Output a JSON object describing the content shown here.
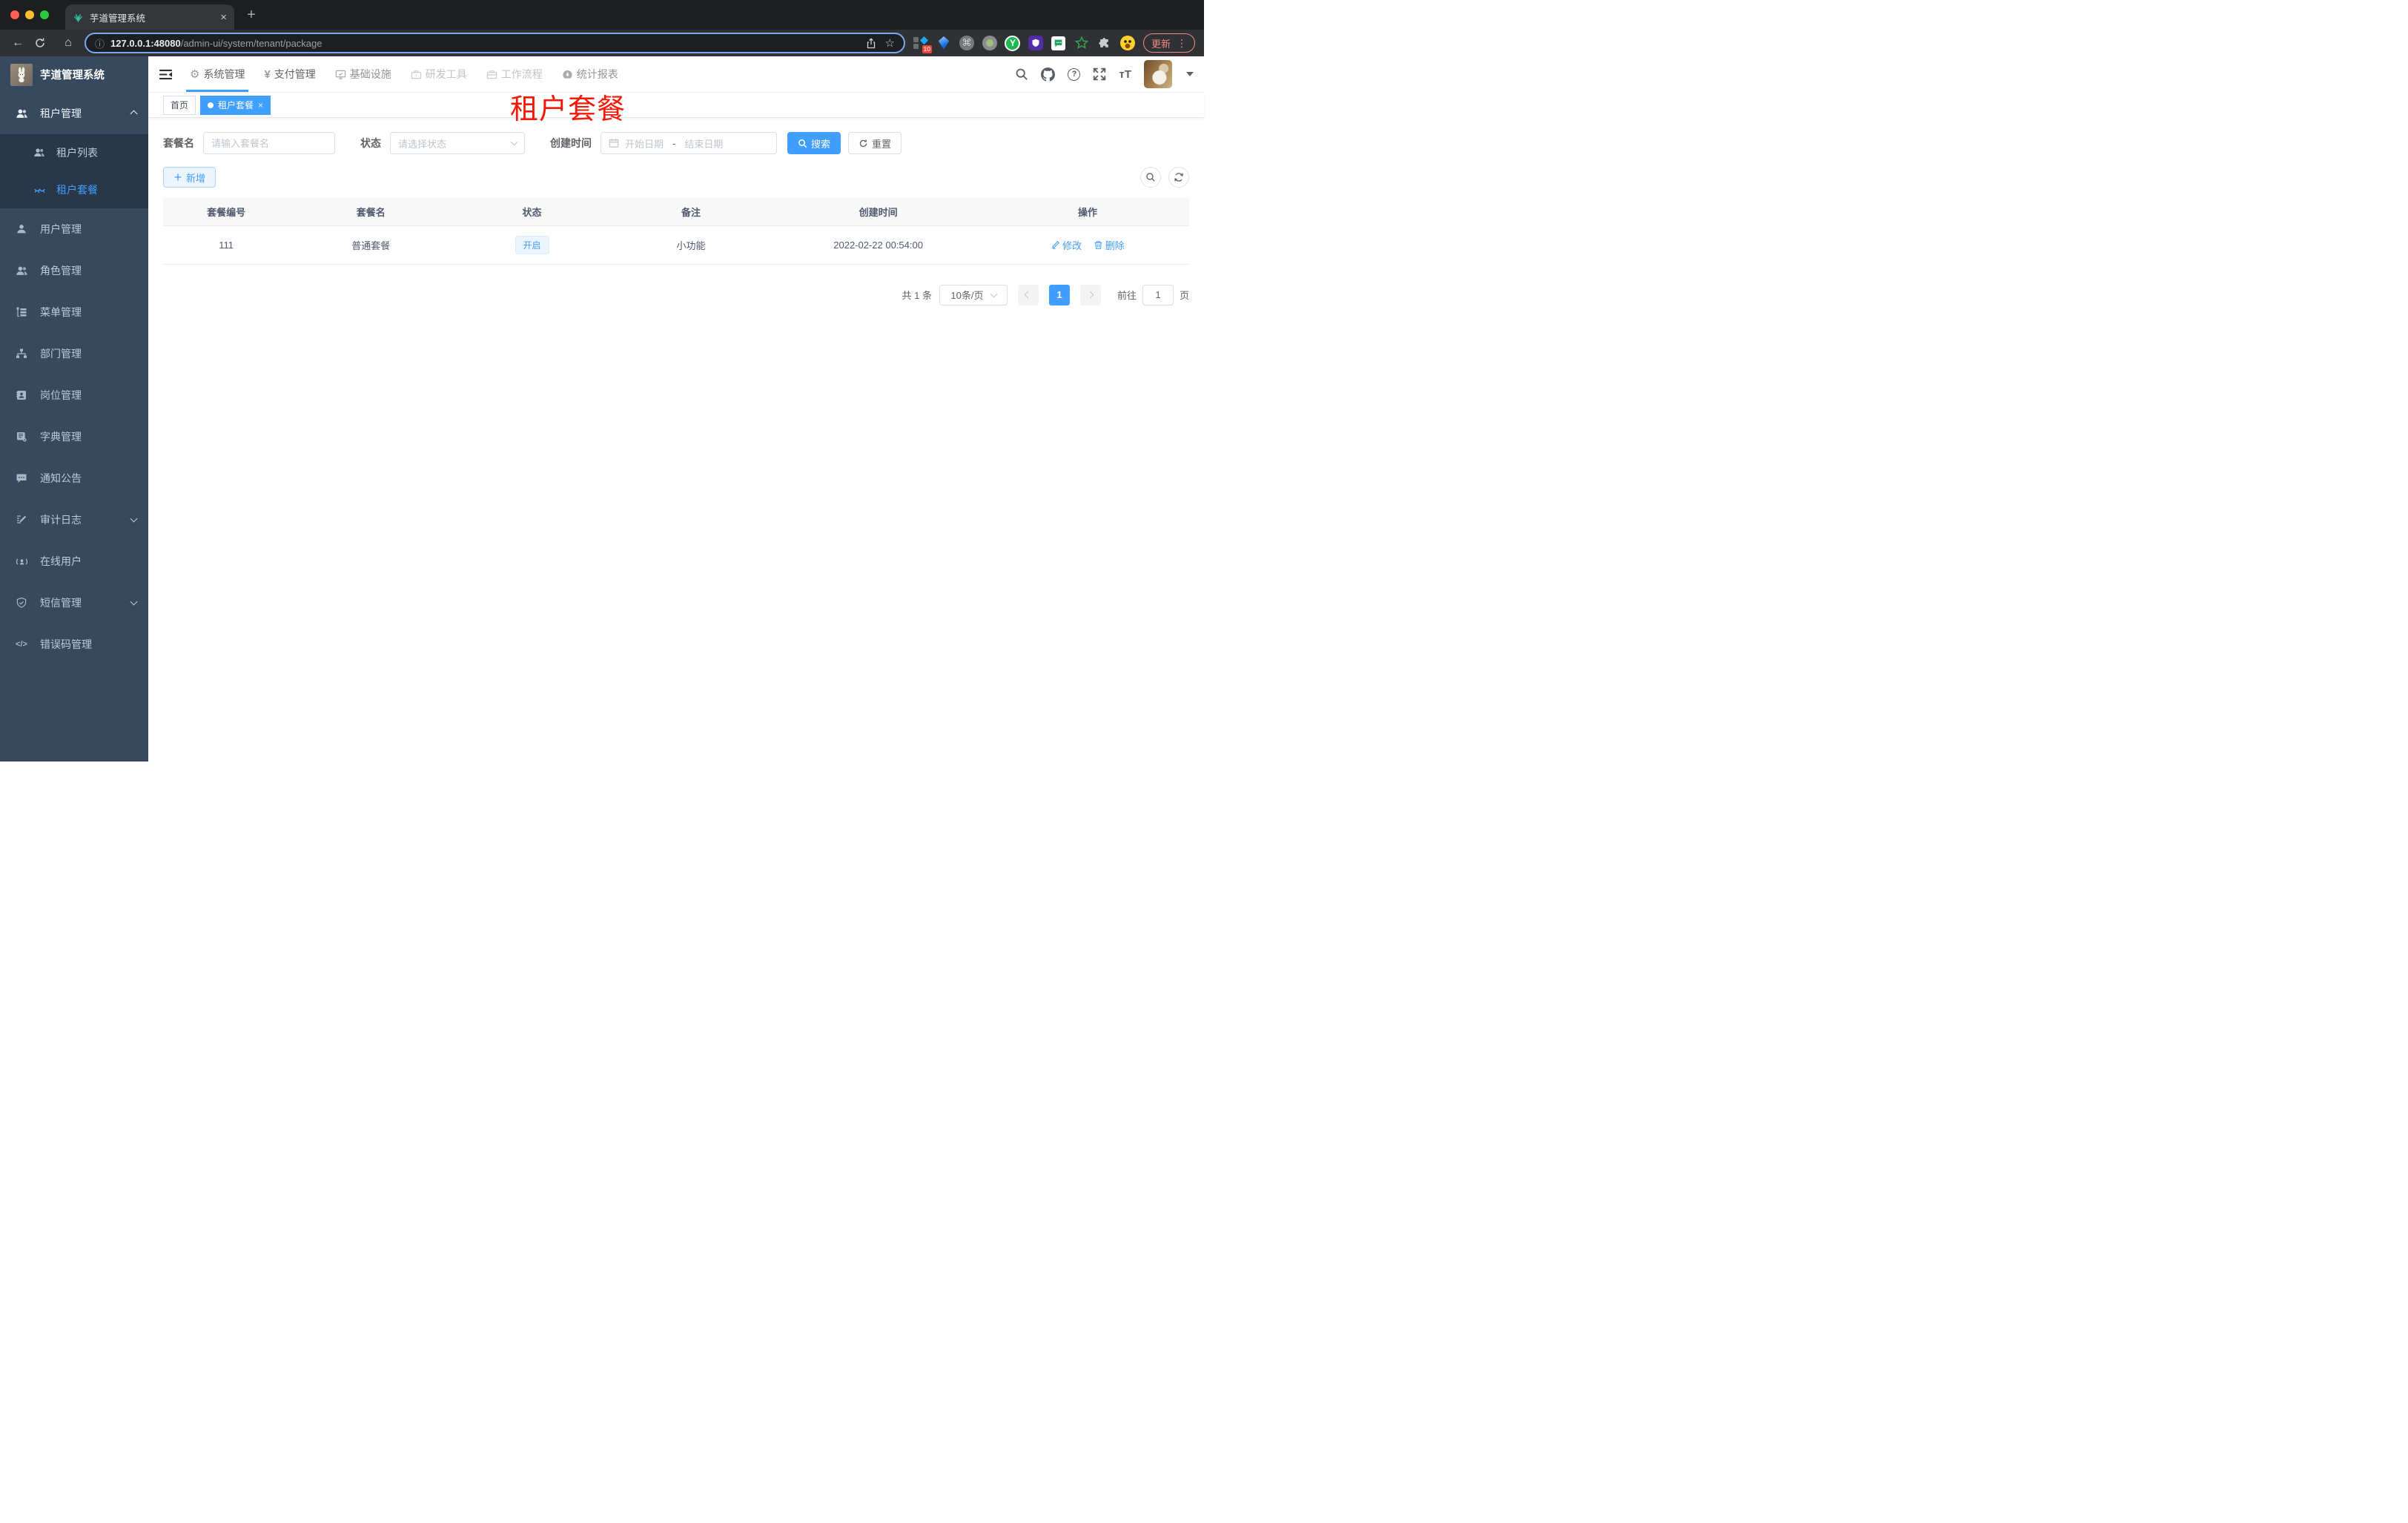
{
  "browser": {
    "tab_title": "芋道管理系统",
    "url_host": "127.0.0.1:48080",
    "url_path": "/admin-ui/system/tenant/package",
    "update_label": "更新",
    "ext_badge": "10"
  },
  "icons": {
    "close": "×",
    "new_tab": "+",
    "back": "←",
    "home": "⌂",
    "info": "ⓘ",
    "star": "☆",
    "command": "⌘",
    "kebab": "⋮",
    "gear": "⚙",
    "yen": "¥",
    "question": "?",
    "font_size": "тT",
    "code": "</>",
    "ext_y": "Y",
    "tag_close": "×"
  },
  "sidebar": {
    "app_title": "芋道管理系统",
    "items": [
      {
        "label": "租户管理"
      },
      {
        "label": "租户列表"
      },
      {
        "label": "租户套餐"
      },
      {
        "label": "用户管理"
      },
      {
        "label": "角色管理"
      },
      {
        "label": "菜单管理"
      },
      {
        "label": "部门管理"
      },
      {
        "label": "岗位管理"
      },
      {
        "label": "字典管理"
      },
      {
        "label": "通知公告"
      },
      {
        "label": "审计日志"
      },
      {
        "label": "在线用户"
      },
      {
        "label": "短信管理"
      },
      {
        "label": "错误码管理"
      }
    ]
  },
  "header": {
    "menus": [
      {
        "label": "系统管理"
      },
      {
        "label": "支付管理"
      },
      {
        "label": "基础设施"
      },
      {
        "label": "研发工具"
      },
      {
        "label": "工作流程"
      },
      {
        "label": "统计报表"
      }
    ]
  },
  "tags": {
    "home": "首页",
    "active": "租户套餐"
  },
  "overlay_title": "租户套餐",
  "filters": {
    "name_label": "套餐名",
    "name_placeholder": "请输入套餐名",
    "status_label": "状态",
    "status_placeholder": "请选择状态",
    "time_label": "创建时间",
    "start_placeholder": "开始日期",
    "range_separator": "-",
    "end_placeholder": "结束日期",
    "search_label": "搜索",
    "reset_label": "重置"
  },
  "toolbar": {
    "add_label": "新增"
  },
  "table": {
    "headers": [
      "套餐编号",
      "套餐名",
      "状态",
      "备注",
      "创建时间",
      "操作"
    ],
    "row": {
      "id": "111",
      "name": "普通套餐",
      "status": "开启",
      "remark": "小功能",
      "create_time": "2022-02-22 00:54:00",
      "edit_label": "修改",
      "delete_label": "删除"
    }
  },
  "pagination": {
    "total": "共 1 条",
    "page_size": "10条/页",
    "current_page": "1",
    "goto_label": "前往",
    "goto_value": "1",
    "page_unit": "页"
  },
  "colors": {
    "primary": "#409eff",
    "sidebar_bg": "#36495e",
    "submenu_bg": "#283848",
    "update_red": "#f28b82",
    "overlay_red": "#f31806",
    "active_tag_bg": "#409eff"
  }
}
